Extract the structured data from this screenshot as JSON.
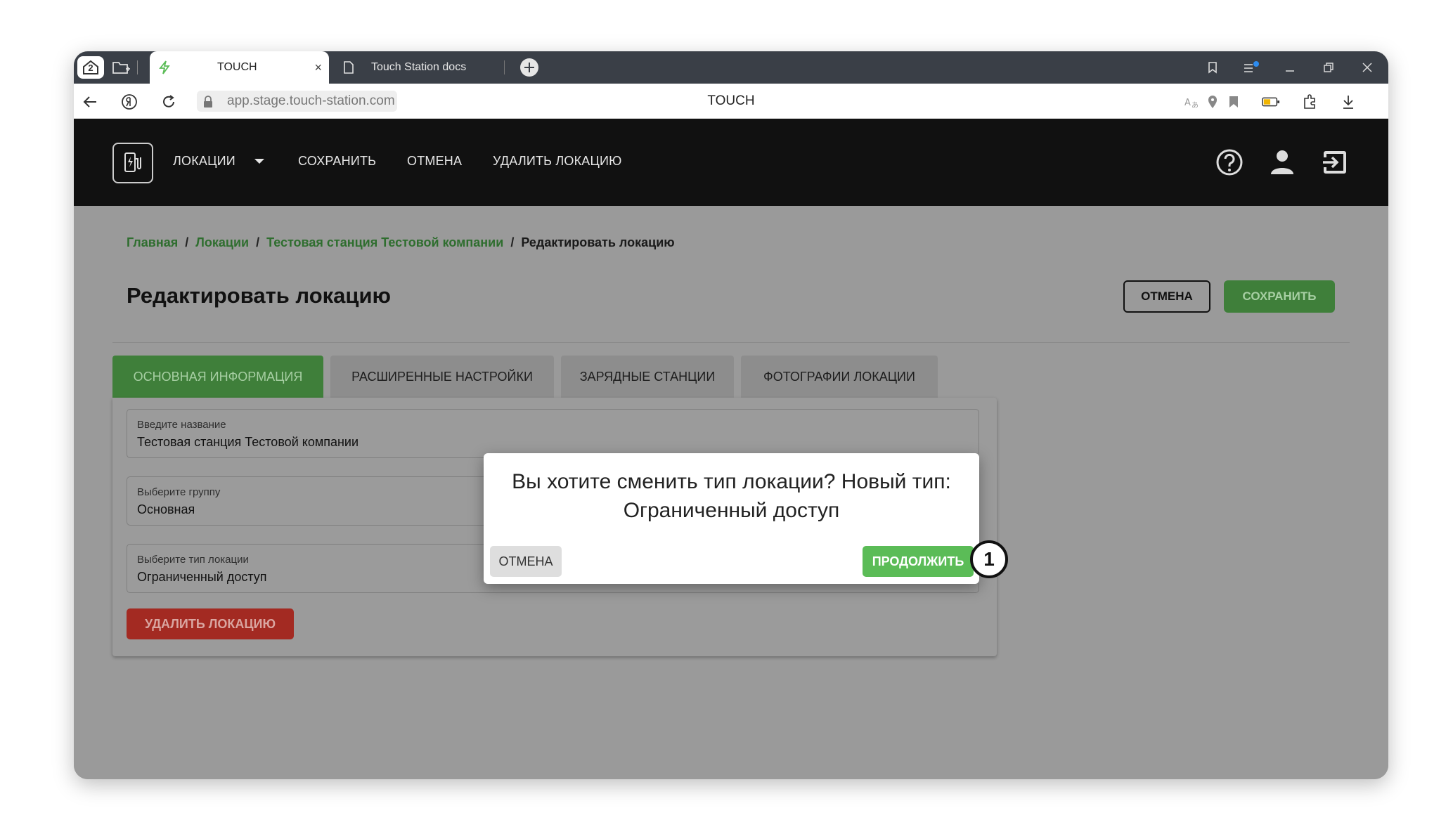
{
  "browser": {
    "home_badge": "2",
    "tabs": [
      {
        "title": "TOUCH",
        "close": "×"
      },
      {
        "title": "Touch Station docs"
      }
    ],
    "new_tab": "+",
    "url": "app.stage.touch-station.com",
    "page_title": "TOUCH"
  },
  "header": {
    "nav": {
      "locations": "ЛОКАЦИИ",
      "save": "СОХРАНИТЬ",
      "cancel": "ОТМЕНА",
      "delete_location": "УДАЛИТЬ ЛОКАЦИЮ"
    },
    "icons": [
      "help-icon",
      "user-icon",
      "logout-icon"
    ]
  },
  "breadcrumb": {
    "home": "Главная",
    "locations": "Локации",
    "station": "Тестовая станция Тестовой компании",
    "current": "Редактировать локацию",
    "separator": "/"
  },
  "page": {
    "title": "Редактировать локацию",
    "cancel_button": "ОТМЕНА",
    "save_button": "СОХРАНИТЬ"
  },
  "tabs": [
    {
      "label": "ОСНОВНАЯ ИНФОРМАЦИЯ",
      "active": true
    },
    {
      "label": "РАСШИРЕННЫЕ НАСТРОЙКИ"
    },
    {
      "label": "ЗАРЯДНЫЕ СТАНЦИИ"
    },
    {
      "label": "ФОТОГРАФИИ ЛОКАЦИИ"
    }
  ],
  "form": {
    "name": {
      "label": "Введите название",
      "value": "Тестовая станция Тестовой компании"
    },
    "group": {
      "label": "Выберите группу",
      "value": "Основная"
    },
    "type": {
      "label": "Выберите тип локации",
      "value": "Ограниченный доступ"
    },
    "delete_button": "УДАЛИТЬ ЛОКАЦИЮ"
  },
  "dialog": {
    "message": "Вы хотите сменить тип локации? Новый тип: Ограниченный доступ",
    "cancel": "ОТМЕНА",
    "continue": "ПРОДОЛЖИТЬ"
  },
  "marker": "1",
  "colors": {
    "accent_green": "#5bbc57",
    "dark_green": "#3f7f3a",
    "danger": "#a32a22",
    "header_bg": "#111111"
  }
}
